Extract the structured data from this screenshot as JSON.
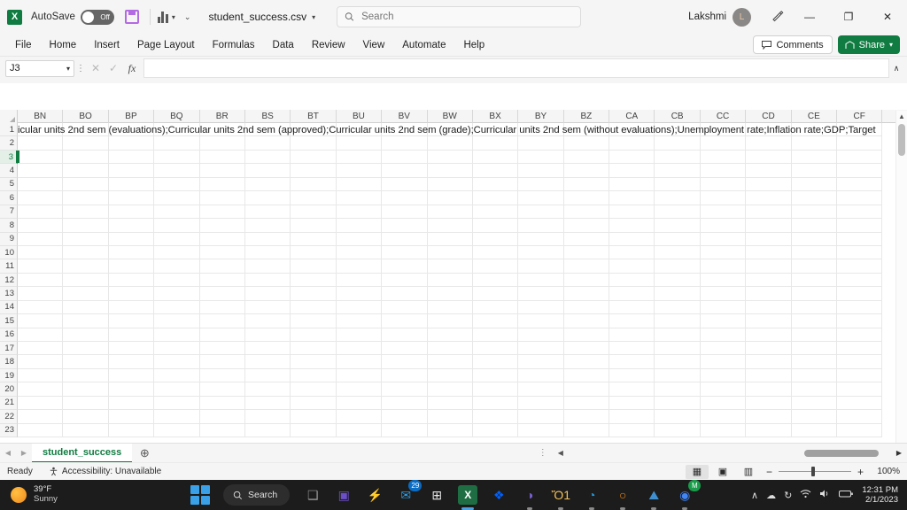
{
  "titlebar": {
    "app_icon": "excel-icon",
    "autosave_label": "AutoSave",
    "autosave_state": "Off",
    "save_icon": "save-icon",
    "quick_chart_icon": "chart-icon",
    "customize_qat_icon": "chevron-down-icon",
    "filename": "student_success.csv",
    "filename_caret": "∨",
    "search_placeholder": "Search",
    "search_icon": "search-icon",
    "user_name": "Lakshmi",
    "avatar_initial": "L",
    "pen_icon": "pen-icon",
    "minimize": "—",
    "restore": "❐",
    "close": "✕"
  },
  "ribbon": {
    "tabs": [
      "File",
      "Home",
      "Insert",
      "Page Layout",
      "Formulas",
      "Data",
      "Review",
      "View",
      "Automate",
      "Help"
    ],
    "comments_label": "Comments",
    "comments_icon": "comment-icon",
    "share_label": "Share",
    "share_icon": "share-icon",
    "share_caret": "∨"
  },
  "formulabar": {
    "namebox_value": "J3",
    "namebox_caret": "∨",
    "dots_icon": "more-options-icon",
    "cancel_icon": "✕",
    "enter_icon": "✓",
    "fx_label": "fx",
    "formula_value": "",
    "expand_icon": "∧"
  },
  "grid": {
    "columns": [
      "BN",
      "BO",
      "BP",
      "BQ",
      "BR",
      "BS",
      "BT",
      "BU",
      "BV",
      "BW",
      "BX",
      "BY",
      "BZ",
      "CA",
      "CB",
      "CC",
      "CD",
      "CE",
      "CF"
    ],
    "rows": [
      1,
      2,
      3,
      4,
      5,
      6,
      7,
      8,
      9,
      10,
      11,
      12,
      13,
      14,
      15,
      16,
      17,
      18,
      19,
      20,
      21,
      22,
      23
    ],
    "active_row": 3,
    "row1_text": "icular units 2nd sem (evaluations);Curricular units 2nd sem (approved);Curricular units 2nd sem (grade);Curricular units 2nd sem (without evaluations);Unemployment rate;Inflation rate;GDP;Target",
    "scroll_up_icon": "▲",
    "scroll_down_icon": "▼"
  },
  "sheetbar": {
    "prev_icon": "◀",
    "next_icon": "▶",
    "tabs": [
      "student_success"
    ],
    "active_tab": "student_success",
    "add_sheet_icon": "⊕",
    "hscroll_left_icon": "◀",
    "hscroll_right_icon": "▶",
    "hscroll_dots": "⋮"
  },
  "statusbar": {
    "mode": "Ready",
    "accessibility": "Accessibility: Unavailable",
    "accessibility_icon": "accessibility-icon",
    "views": [
      {
        "name": "normal-view",
        "icon": "▦",
        "active": true
      },
      {
        "name": "page-layout-view",
        "icon": "▣",
        "active": false
      },
      {
        "name": "page-break-view",
        "icon": "▥",
        "active": false
      }
    ],
    "zoom_out": "−",
    "zoom_in": "+",
    "zoom_level": "100%"
  },
  "taskbar": {
    "weather_temp": "39°F",
    "weather_desc": "Sunny",
    "weather_icon": "sun-icon",
    "start_icon": "windows-start-icon",
    "search_label": "Search",
    "search_icon": "search-icon",
    "items": [
      {
        "name": "task-view-icon",
        "glyph": "❑",
        "color": "#9a9a9a",
        "badge": null,
        "running": false
      },
      {
        "name": "teams-icon",
        "glyph": "▣",
        "color": "#6b4fc8",
        "badge": null,
        "running": false
      },
      {
        "name": "lightning-app-icon",
        "glyph": "⚡",
        "color": "#d8d8d8",
        "badge": null,
        "running": false
      },
      {
        "name": "mail-icon",
        "glyph": "✉",
        "color": "#2f9ae0",
        "badge": "29",
        "running": false
      },
      {
        "name": "microsoft-store-icon",
        "glyph": "⊞",
        "color": "#e8e8e8",
        "badge": null,
        "running": false
      },
      {
        "name": "excel-icon",
        "glyph": "X",
        "color": "#1f6e43",
        "badge": null,
        "running": true
      },
      {
        "name": "dropbox-icon",
        "glyph": "❖",
        "color": "#0061fe",
        "badge": null,
        "running": false
      },
      {
        "name": "microsoft-365-icon",
        "glyph": "◑",
        "color": "#7a5fd3",
        "badge": null,
        "running": true
      },
      {
        "name": "file-explorer-icon",
        "glyph": "Ὄ1",
        "color": "#f6c358",
        "badge": null,
        "running": true
      },
      {
        "name": "edge-icon",
        "glyph": "◔",
        "color": "#1f9ae0",
        "badge": null,
        "running": true
      },
      {
        "name": "python-icon",
        "glyph": "○",
        "color": "#f08a1a",
        "badge": null,
        "running": true
      },
      {
        "name": "photos-icon",
        "glyph": "⛰",
        "color": "#3f8fd0",
        "badge": null,
        "running": true
      },
      {
        "name": "chrome-icon",
        "glyph": "◉",
        "color": "#4285f4",
        "badge": "M",
        "running": true
      }
    ],
    "tray": {
      "chevron": "∧",
      "cloud_icon": "onedrive-icon",
      "sync_icon": "sync-icon",
      "wifi_icon": "◠",
      "volume_icon": "ὐA",
      "battery_icon": "▭",
      "time": "12:31 PM",
      "date": "2/1/2023"
    }
  }
}
